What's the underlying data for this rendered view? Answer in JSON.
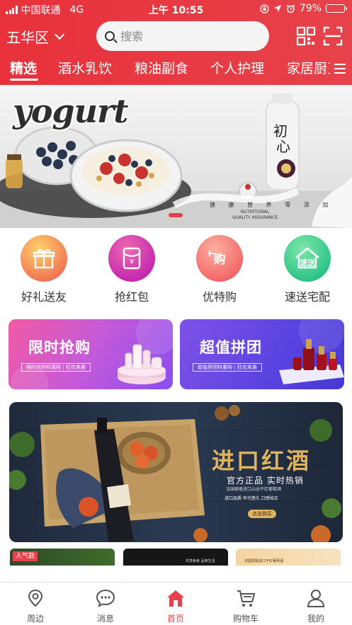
{
  "status_bar": {
    "carrier": "中国联通",
    "network": "4G",
    "time": "上午 10:55",
    "battery": "79%"
  },
  "header": {
    "location": "五华区",
    "search_placeholder": "搜索"
  },
  "category_tabs": [
    {
      "label": "精选",
      "active": true
    },
    {
      "label": "酒水乳饮",
      "active": false
    },
    {
      "label": "粮油副食",
      "active": false
    },
    {
      "label": "个人护理",
      "active": false
    },
    {
      "label": "家居厨卫",
      "active": false
    }
  ],
  "banner": {
    "brand_text": "yogurt",
    "product_name": "初心",
    "tagline": "健 康 营 养 零 添 加",
    "sub_line1": "NUTRITIONAL",
    "sub_line2": "QUALITY ASSURANCE",
    "active_slide": 1
  },
  "quick_links": [
    {
      "label": "好礼送友",
      "icon": "gift-icon"
    },
    {
      "label": "抢红包",
      "icon": "red-envelope-icon"
    },
    {
      "label": "优特购",
      "icon": "shop-icon"
    },
    {
      "label": "速送宅配",
      "icon": "house-delivery-icon"
    }
  ],
  "promos": [
    {
      "title": "限时抢购",
      "subtitle": "限时抢购特惠购 | 狂欢来袭"
    },
    {
      "title": "超值拼团",
      "subtitle": "超值拼团特惠购 | 狂欢来袭"
    }
  ],
  "wine_banner": {
    "title": "进口红酒",
    "subtitle": "官方正品  实时热销",
    "small_text": "法国原瓶进口山谷干红葡萄酒",
    "features": "进口品质   年代悠久   口感纯正",
    "cta": "点击购买"
  },
  "strip_cards": [
    {
      "tag": "人气款",
      "text": ""
    },
    {
      "tag": "",
      "text": "共享美食 品味生活"
    },
    {
      "tag": "",
      "text": "法国原瓶进口干红葡萄酒"
    }
  ],
  "tabbar": [
    {
      "label": "周边",
      "icon": "location-pin-icon",
      "active": false
    },
    {
      "label": "消息",
      "icon": "message-icon",
      "active": false
    },
    {
      "label": "首页",
      "icon": "home-icon",
      "active": true
    },
    {
      "label": "购物车",
      "icon": "cart-icon",
      "active": false
    },
    {
      "label": "我的",
      "icon": "user-icon",
      "active": false
    }
  ],
  "colors": {
    "brand_red": "#e7424b",
    "header_red": "#e8313b"
  }
}
